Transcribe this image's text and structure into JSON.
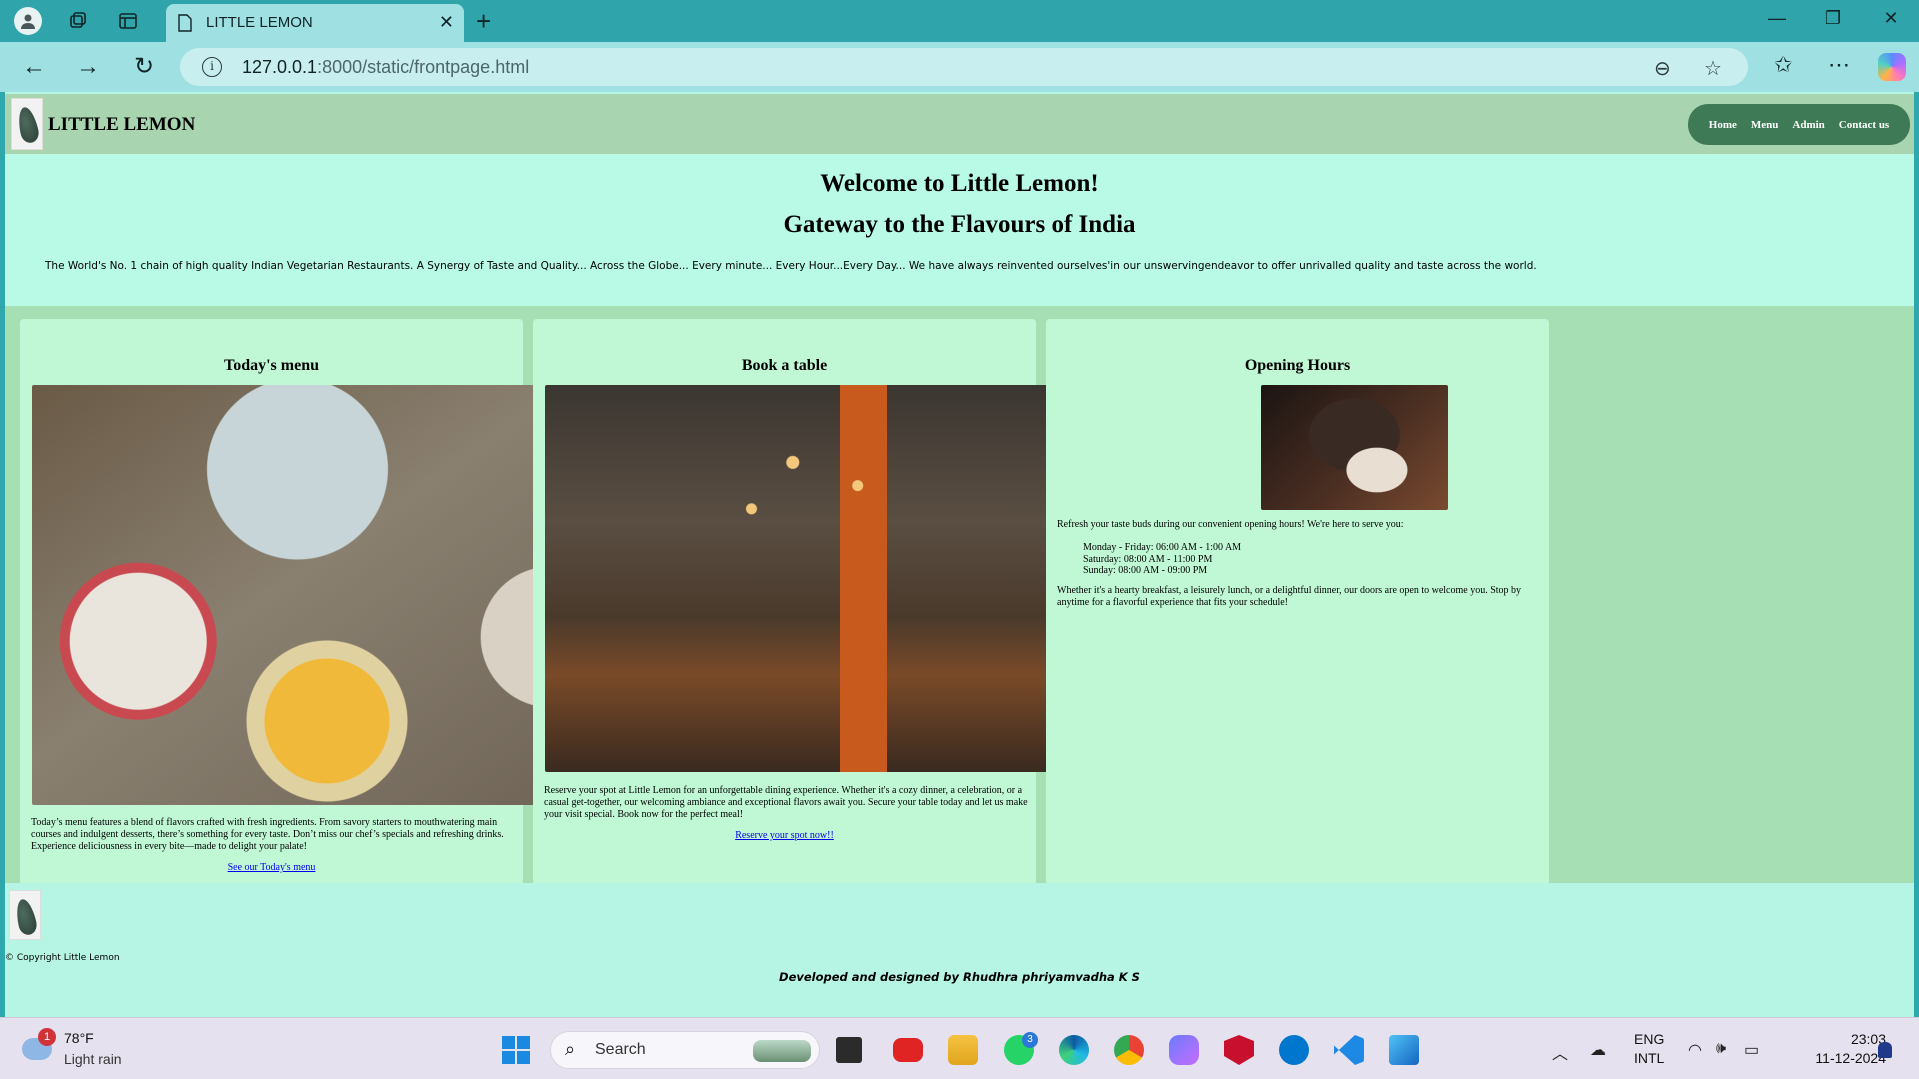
{
  "browser": {
    "tab_title": "LITTLE LEMON",
    "url_host": "127.0.0.1",
    "url_rest": ":8000/static/frontpage.html"
  },
  "site": {
    "brand": "LITTLE LEMON",
    "nav": [
      "Home",
      "Menu",
      "Admin",
      "Contact us"
    ],
    "hero_title": "Welcome to Little Lemon!",
    "hero_subtitle": "Gateway to the Flavours of India",
    "hero_text": "The World's No. 1 chain of high quality Indian Vegetarian Restaurants. A Synergy of Taste and Quality... Across the Globe... Every minute... Every Hour...Every Day... We have always reinvented ourselves'in our unswervingendeavor to offer unrivalled quality and taste across the world.",
    "cards": {
      "menu": {
        "title": "Today's menu",
        "text": "Today’s menu features a blend of flavors crafted with fresh ingredients. From savory starters to mouthwatering main courses and indulgent desserts, there’s something for every taste. Don’t miss our chef’s specials and refreshing drinks. Experience deliciousness in every bite—made to delight your palate!",
        "link": "See our Today's menu"
      },
      "book": {
        "title": "Book a table",
        "text": "Reserve your spot at Little Lemon for an unforgettable dining experience. Whether it's a cozy dinner, a celebration, or a casual get-together, our welcoming ambiance and exceptional flavors await you. Secure your table today and let us make your visit special. Book now for the perfect meal!",
        "link": "Reserve your spot now!!"
      },
      "hours": {
        "title": "Opening Hours",
        "intro": "Refresh your taste buds during our convenient opening hours! We're here to serve you:",
        "weekday": "Monday - Friday: 06:00 AM - 1:00 AM",
        "saturday": "Saturday: 08:00 AM - 11:00 PM",
        "sunday": "Sunday: 08:00 AM - 09:00 PM",
        "outro": "Whether it's a hearty breakfast, a leisurely lunch, or a delightful dinner, our doors are open to welcome you. Stop by anytime for a flavorful experience that fits your schedule!"
      }
    },
    "footer": {
      "copyright": "© Copyright Little Lemon",
      "developer": "Developed and designed by Rhudhra phriyamvadha K S"
    }
  },
  "taskbar": {
    "weather_badge": "1",
    "temperature": "78°F",
    "condition": "Light rain",
    "search_label": "Search",
    "whatsapp_badge": "3",
    "lang_top": "ENG",
    "lang_bottom": "INTL",
    "time": "23:03",
    "date": "11-12-2024"
  }
}
